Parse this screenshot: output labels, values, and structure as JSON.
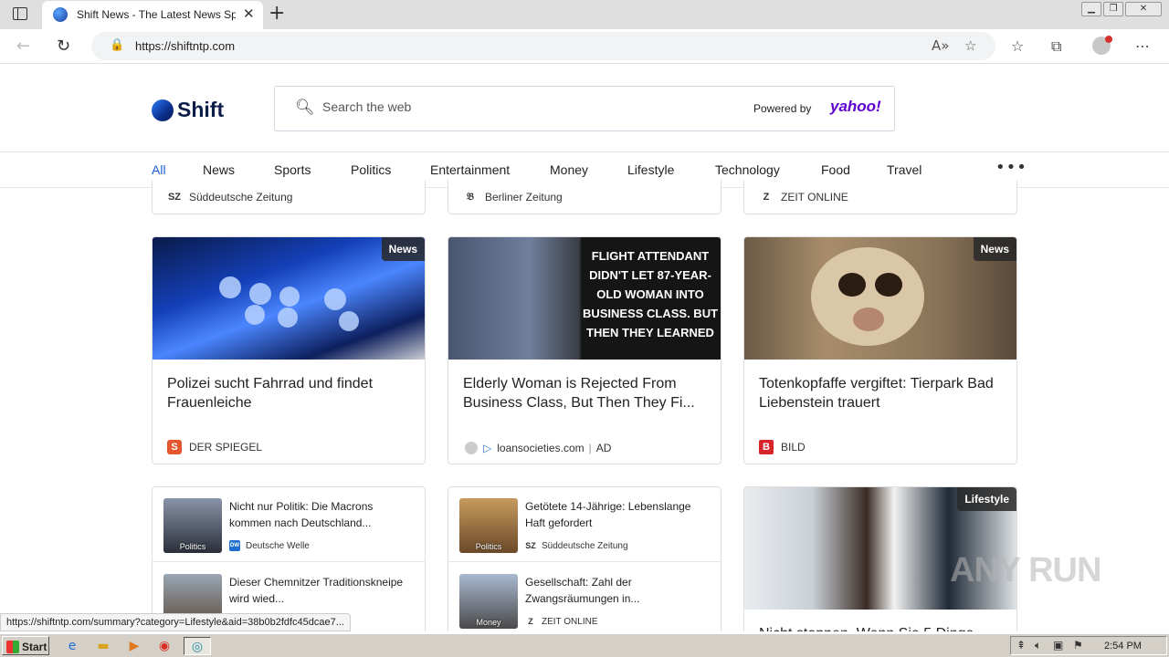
{
  "browser": {
    "tab_title": "Shift News - The Latest News Spo",
    "url": "https://shiftntp.com",
    "status_url": "https://shiftntp.com/summary?category=Lifestyle&aid=38b0b2fdfc45dcae7...",
    "win_min": "▁",
    "win_max": "❐",
    "win_close": "✕"
  },
  "site": {
    "logo_text": "Shift",
    "search_placeholder": "Search the web",
    "powered_by": "Powered by",
    "yahoo": "yahoo!",
    "nav": [
      "All",
      "News",
      "Sports",
      "Politics",
      "Entertainment",
      "Money",
      "Lifestyle",
      "Technology",
      "Food",
      "Travel"
    ],
    "more": "•••"
  },
  "top_sources": [
    {
      "name": "Süddeutsche Zeitung",
      "icon": "SZ"
    },
    {
      "name": "Berliner Zeitung",
      "icon": "𝔅"
    },
    {
      "name": "ZEIT ONLINE",
      "icon": "Z"
    }
  ],
  "cards": [
    {
      "badge": "News",
      "headline": "Polizei sucht Fahrrad und findet Frauenleiche",
      "source": "DER SPIEGEL",
      "source_icon": "S",
      "image_text": ""
    },
    {
      "badge": "",
      "headline": "Elderly Woman is Rejected From Business Class, But Then They Fi...",
      "source": "loansocieties.com",
      "ad": "AD",
      "image_text": "FLIGHT ATTENDANT DIDN'T LET 87-YEAR-OLD WOMAN INTO BUSINESS CLASS. BUT THEN THEY LEARNED"
    },
    {
      "badge": "News",
      "headline": "Totenkopfaffe vergiftet: Tierpark Bad Liebenstein trauert",
      "source": "BILD",
      "source_icon": "B",
      "image_text": ""
    }
  ],
  "mini_col1": [
    {
      "title": "Nicht nur Politik: Die Macrons kommen nach Deutschland...",
      "source": "Deutsche Welle",
      "icon": "DW",
      "label": "Politics"
    },
    {
      "title": "Dieser Chemnitzer Traditionskneipe wird wied...",
      "source": "",
      "icon": "",
      "label": ""
    }
  ],
  "mini_col2": [
    {
      "title": "Getötete 14-Jährige: Lebenslange Haft gefordert",
      "source": "Süddeutsche Zeitung",
      "icon": "SZ",
      "label": "Politics"
    },
    {
      "title": "Gesellschaft: Zahl der Zwangsräumungen in...",
      "source": "ZEIT ONLINE",
      "icon": "Z",
      "label": "Money"
    }
  ],
  "lifestyle_card": {
    "badge": "Lifestyle",
    "headline": "Nicht stoppen, Wenn Sie 5 Dinge"
  },
  "watermark": "ANY RUN",
  "taskbar": {
    "start": "Start",
    "clock": "2:54 PM"
  }
}
